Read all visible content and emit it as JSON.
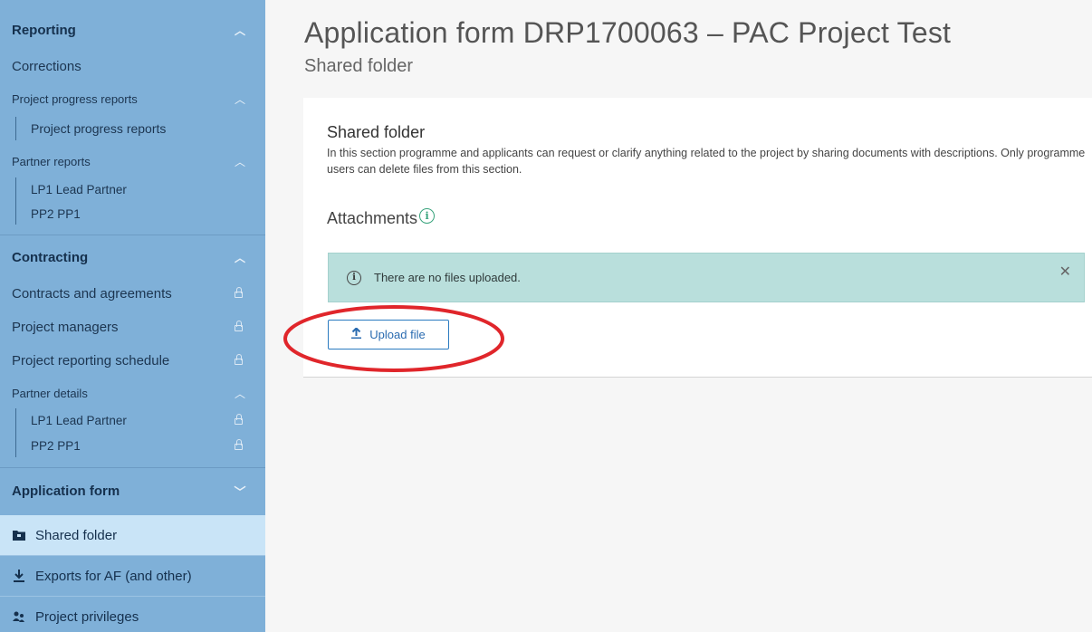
{
  "sidebar": {
    "reporting": {
      "header": "Reporting",
      "corrections": "Corrections",
      "progress_group": "Project progress reports",
      "progress_item": "Project progress reports",
      "partner_group": "Partner reports",
      "partner_items": [
        "LP1 Lead Partner",
        "PP2 PP1"
      ]
    },
    "contracting": {
      "header": "Contracting",
      "items": [
        "Contracts and agreements",
        "Project managers",
        "Project reporting schedule"
      ],
      "partner_details_group": "Partner details",
      "partner_details_items": [
        "LP1 Lead Partner",
        "PP2 PP1"
      ]
    },
    "application_form": {
      "header": "Application form",
      "items": [
        "Shared folder",
        "Exports for AF (and other)",
        "Project privileges"
      ]
    },
    "icons": {
      "chevron_up": "chevron-up-icon",
      "chevron_down": "chevron-down-icon",
      "lock": "lock-icon",
      "folder": "folder-icon",
      "download": "download-icon",
      "privileges": "users-icon"
    }
  },
  "main": {
    "title": "Application form DRP1700063 – PAC Project Test",
    "subtitle": "Shared folder",
    "card": {
      "title": "Shared folder",
      "description": "In this section programme and applicants can request or clarify anything related to the project by sharing documents with descriptions. Only programme users can delete files from this section.",
      "attachments_title": "Attachments",
      "alert_text": "There are no files uploaded.",
      "upload_label": "Upload file"
    }
  },
  "colors": {
    "sidebar_bg": "#7fb0d8",
    "sidebar_active": "#c9e4f7",
    "alert_bg": "#b9dfdc",
    "accent": "#2a6bb0",
    "annotation": "#e0262b"
  }
}
